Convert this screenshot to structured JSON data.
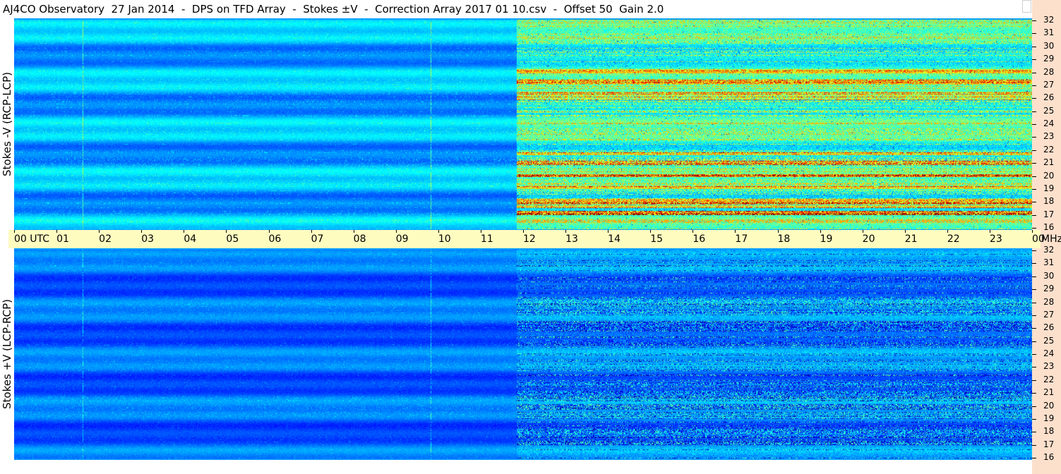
{
  "title": "AJ4CO Observatory  27 Jan 2014  -  DPS on TFD Array  -  Stokes ±V  -  Correction Array 2017 01 10.csv  -  Offset 50  Gain 2.0",
  "chart_data": [
    {
      "type": "heatmap",
      "ylabel": "Stokes -V (RCP-LCP)",
      "xticks": [
        "00 UTC",
        "01",
        "02",
        "03",
        "04",
        "05",
        "06",
        "07",
        "08",
        "09",
        "10",
        "11",
        "12",
        "13",
        "14",
        "15",
        "16",
        "17",
        "18",
        "19",
        "20",
        "21",
        "22",
        "23",
        "00"
      ],
      "yticks": [
        "16",
        "17",
        "18",
        "19",
        "20",
        "21",
        "22",
        "23",
        "24",
        "25",
        "26",
        "27",
        "28",
        "29",
        "30",
        "31",
        "32"
      ],
      "yunit": "MHz",
      "xlim": [
        0,
        24
      ],
      "ylim": [
        16,
        32
      ]
    },
    {
      "type": "heatmap",
      "ylabel": "Stokes +V (LCP-RCP)",
      "xticks": [
        "00 UTC",
        "01",
        "02",
        "03",
        "04",
        "05",
        "06",
        "07",
        "08",
        "09",
        "10",
        "11",
        "12",
        "13",
        "14",
        "15",
        "16",
        "17",
        "18",
        "19",
        "20",
        "21",
        "22",
        "23",
        "00"
      ],
      "yticks": [
        "16",
        "17",
        "18",
        "19",
        "20",
        "21",
        "22",
        "23",
        "24",
        "25",
        "26",
        "27",
        "28",
        "29",
        "30",
        "31",
        "32"
      ],
      "yunit": "MHz",
      "xlim": [
        0,
        24
      ],
      "ylim": [
        16,
        32
      ]
    }
  ],
  "colors": {
    "title_bg": "#ffffff",
    "axis_bg": "#fffcc0",
    "right_strip_bg": "#fde0cc",
    "spectrogram_base": "#1060e0"
  }
}
